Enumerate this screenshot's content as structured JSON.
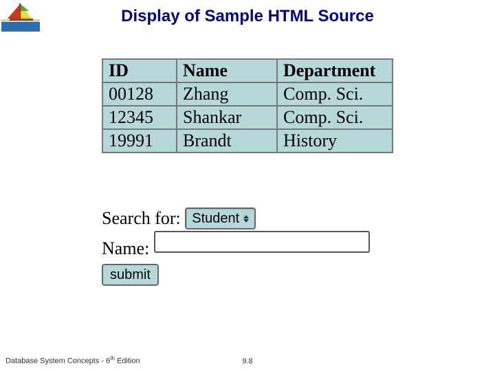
{
  "slide": {
    "title": "Display of Sample HTML Source",
    "footer_book": "Database System Concepts - 6",
    "footer_sup": "th",
    "footer_edition": " Edition",
    "slide_number": "9.8"
  },
  "table": {
    "headers": {
      "id": "ID",
      "name": "Name",
      "dept": "Department"
    },
    "rows": [
      {
        "id": "00128",
        "name": "Zhang",
        "dept": "Comp. Sci."
      },
      {
        "id": "12345",
        "name": "Shankar",
        "dept": "Comp. Sci."
      },
      {
        "id": "19991",
        "name": "Brandt",
        "dept": "History"
      }
    ]
  },
  "form": {
    "search_label": "Search for:",
    "search_select_value": "Student",
    "name_label": "Name:",
    "name_input_value": "",
    "submit_label": "submit"
  },
  "chart_data": {
    "type": "table",
    "columns": [
      "ID",
      "Name",
      "Department"
    ],
    "rows": [
      [
        "00128",
        "Zhang",
        "Comp. Sci."
      ],
      [
        "12345",
        "Shankar",
        "Comp. Sci."
      ],
      [
        "19991",
        "Brandt",
        "History"
      ]
    ]
  }
}
